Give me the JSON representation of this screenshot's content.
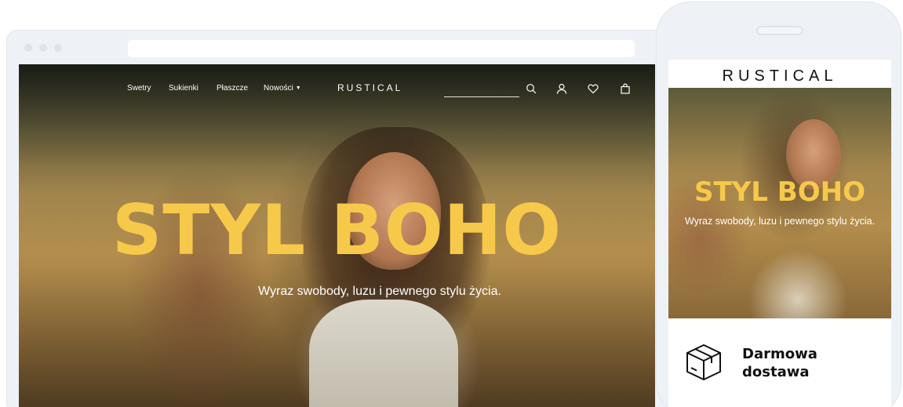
{
  "desktop": {
    "nav": {
      "items": [
        {
          "label": "Swetry"
        },
        {
          "label": "Sukienki"
        },
        {
          "label": "Płaszcze"
        },
        {
          "label": "Nowości",
          "has_dropdown": true
        }
      ],
      "logo": "RUSTICAL",
      "icons": [
        "search-icon",
        "user-icon",
        "heart-icon",
        "cart-icon"
      ]
    },
    "hero": {
      "title": "STYL BOHO",
      "subtitle": "Wyraz swobody, luzu i pewnego stylu życia."
    }
  },
  "mobile": {
    "logo": "RUSTICAL",
    "hero": {
      "title": "STYL BOHO",
      "subtitle": "Wyraz swobody, luzu i pewnego stylu życia."
    },
    "feature": {
      "icon": "box-icon",
      "label": "Darmowa dostawa"
    }
  },
  "colors": {
    "accent": "#f7c94a",
    "mockup_frame": "#eef2f6",
    "text_dark": "#111111"
  }
}
